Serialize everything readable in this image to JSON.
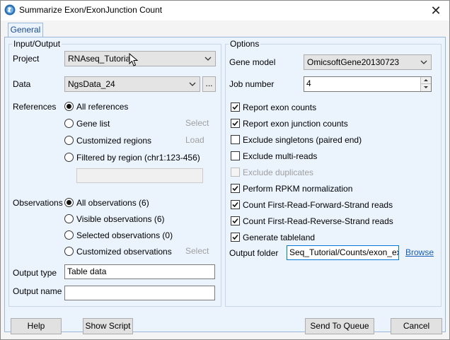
{
  "window": {
    "title": "Summarize Exon/ExonJunction Count",
    "close_label": "✕"
  },
  "tabs": [
    {
      "label": "General"
    }
  ],
  "input_output": {
    "legend": "Input/Output",
    "project_label": "Project",
    "project_value": "RNAseq_Tutorial",
    "data_label": "Data",
    "data_value": "NgsData_24",
    "data_browse_label": "...",
    "references_label": "References",
    "references": {
      "all": "All references",
      "gene_list": "Gene list",
      "gene_list_action": "Select",
      "customized": "Customized regions",
      "customized_action": "Load",
      "filtered": "Filtered by region (chr1:123-456)",
      "filtered_value": ""
    },
    "observations_label": "Observations",
    "observations": {
      "all": "All observations (6)",
      "visible": "Visible observations (6)",
      "selected": "Selected observations (0)",
      "customized": "Customized observations",
      "customized_action": "Select"
    },
    "output_type_label": "Output type",
    "output_type_value": "Table data",
    "output_name_label": "Output name",
    "output_name_value": ""
  },
  "options": {
    "legend": "Options",
    "gene_model_label": "Gene model",
    "gene_model_value": "OmicsoftGene20130723",
    "job_number_label": "Job number",
    "job_number_value": "4",
    "checks": [
      {
        "label": "Report exon counts",
        "checked": true
      },
      {
        "label": "Report exon junction counts",
        "checked": true
      },
      {
        "label": "Exclude singletons (paired end)",
        "checked": false
      },
      {
        "label": "Exclude multi-reads",
        "checked": false
      },
      {
        "label": "Exclude duplicates",
        "checked": false
      },
      {
        "label": "Perform RPKM normalization",
        "checked": true
      },
      {
        "label": "Count First-Read-Forward-Strand reads",
        "checked": true
      },
      {
        "label": "Count First-Read-Reverse-Strand reads",
        "checked": true
      },
      {
        "label": "Generate tableland",
        "checked": true
      }
    ],
    "output_folder_label": "Output folder",
    "output_folder_value": "Seq_Tutorial/Counts/exon_exon",
    "browse_label": "Browse"
  },
  "buttons": {
    "help": "Help",
    "show_script": "Show Script",
    "send_to_queue": "Send To Queue",
    "cancel": "Cancel"
  },
  "colors": {
    "accent": "#1a5fb4",
    "tab_bg": "#ebf3fd"
  }
}
